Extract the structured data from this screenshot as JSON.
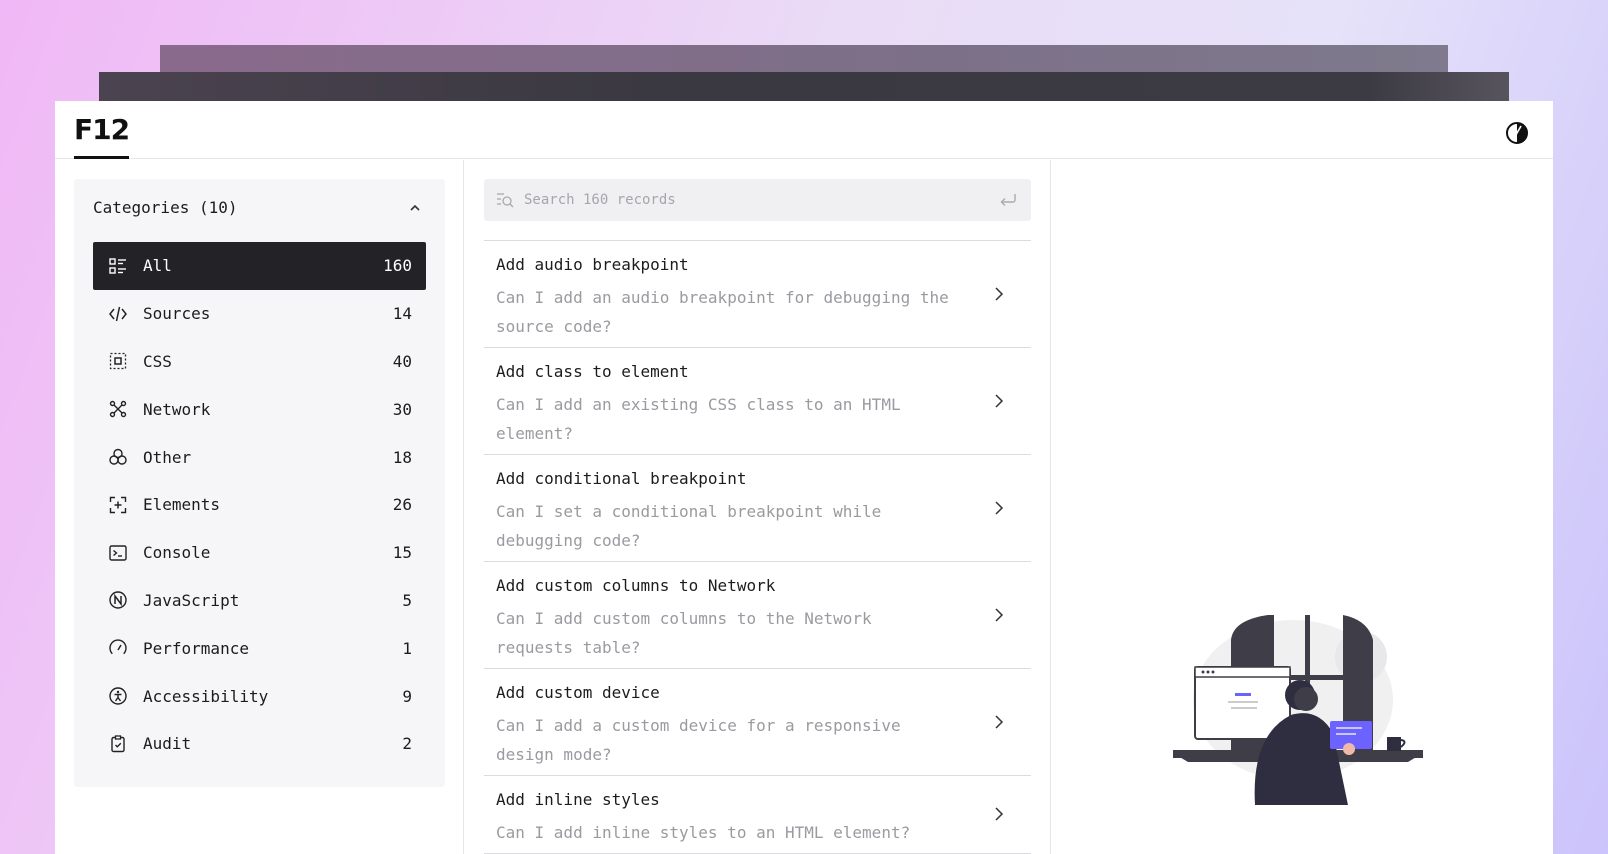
{
  "app": {
    "logo": "F12"
  },
  "categories": {
    "header": "Categories (10)",
    "items": [
      {
        "label": "All",
        "count": "160",
        "icon": "list-icon",
        "active": true
      },
      {
        "label": "Sources",
        "count": "14",
        "icon": "code-icon"
      },
      {
        "label": "CSS",
        "count": "40",
        "icon": "box-select-icon"
      },
      {
        "label": "Network",
        "count": "30",
        "icon": "network-icon"
      },
      {
        "label": "Other",
        "count": "18",
        "icon": "circles-icon"
      },
      {
        "label": "Elements",
        "count": "26",
        "icon": "element-add-icon"
      },
      {
        "label": "Console",
        "count": "15",
        "icon": "terminal-icon"
      },
      {
        "label": "JavaScript",
        "count": "5",
        "icon": "n-circle-icon"
      },
      {
        "label": "Performance",
        "count": "1",
        "icon": "gauge-icon"
      },
      {
        "label": "Accessibility",
        "count": "9",
        "icon": "accessibility-icon"
      },
      {
        "label": "Audit",
        "count": "2",
        "icon": "clipboard-icon"
      }
    ]
  },
  "search": {
    "placeholder": "Search 160 records"
  },
  "records": [
    {
      "title": "Add audio breakpoint",
      "description": "Can I add an audio breakpoint for debugging the source code?"
    },
    {
      "title": "Add class to element",
      "description": "Can I add an existing CSS class to an HTML element?"
    },
    {
      "title": "Add conditional breakpoint",
      "description": "Can I set a conditional breakpoint while debugging code?"
    },
    {
      "title": "Add custom columns to Network",
      "description": "Can I add custom columns to the Network requests table?"
    },
    {
      "title": "Add custom device",
      "description": "Can I add a custom device for a responsive design mode?"
    },
    {
      "title": "Add inline styles",
      "description": "Can I add inline styles to an HTML element?"
    }
  ]
}
